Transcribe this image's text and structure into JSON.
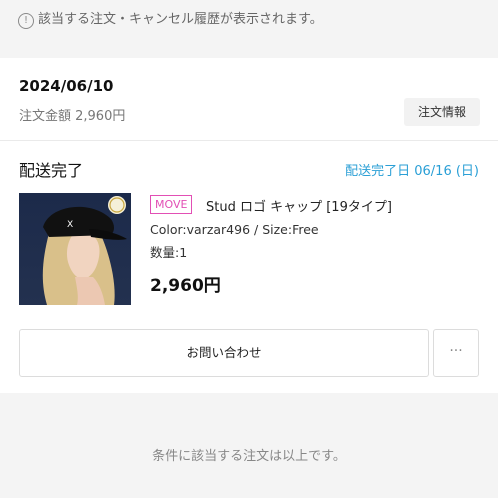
{
  "notice": {
    "icon": "info-icon",
    "icon_glyph": "!",
    "text": "該当する注文・キャンセル履歴が表示されます。"
  },
  "order": {
    "date": "2024/06/10",
    "total": "注文金額 2,960円",
    "info_button": "注文情報"
  },
  "shipment": {
    "status": "配送完了",
    "delivered_date": "配送完了日 06/16 (日)"
  },
  "item": {
    "brand": "MOVE",
    "name": "Stud ロゴ キャップ [19タイプ]",
    "variant": "Color:varzar496 / Size:Free",
    "quantity": "数量:1",
    "price": "2,960円",
    "image": "product-photo-black-cap"
  },
  "actions": {
    "contact_button": "お問い合わせ",
    "more_button": "···"
  },
  "footer": {
    "text": "条件に該当する注文は以上です。"
  },
  "colors": {
    "accent_blue": "#2a9fd6",
    "brand_pink": "#e24fb5"
  }
}
